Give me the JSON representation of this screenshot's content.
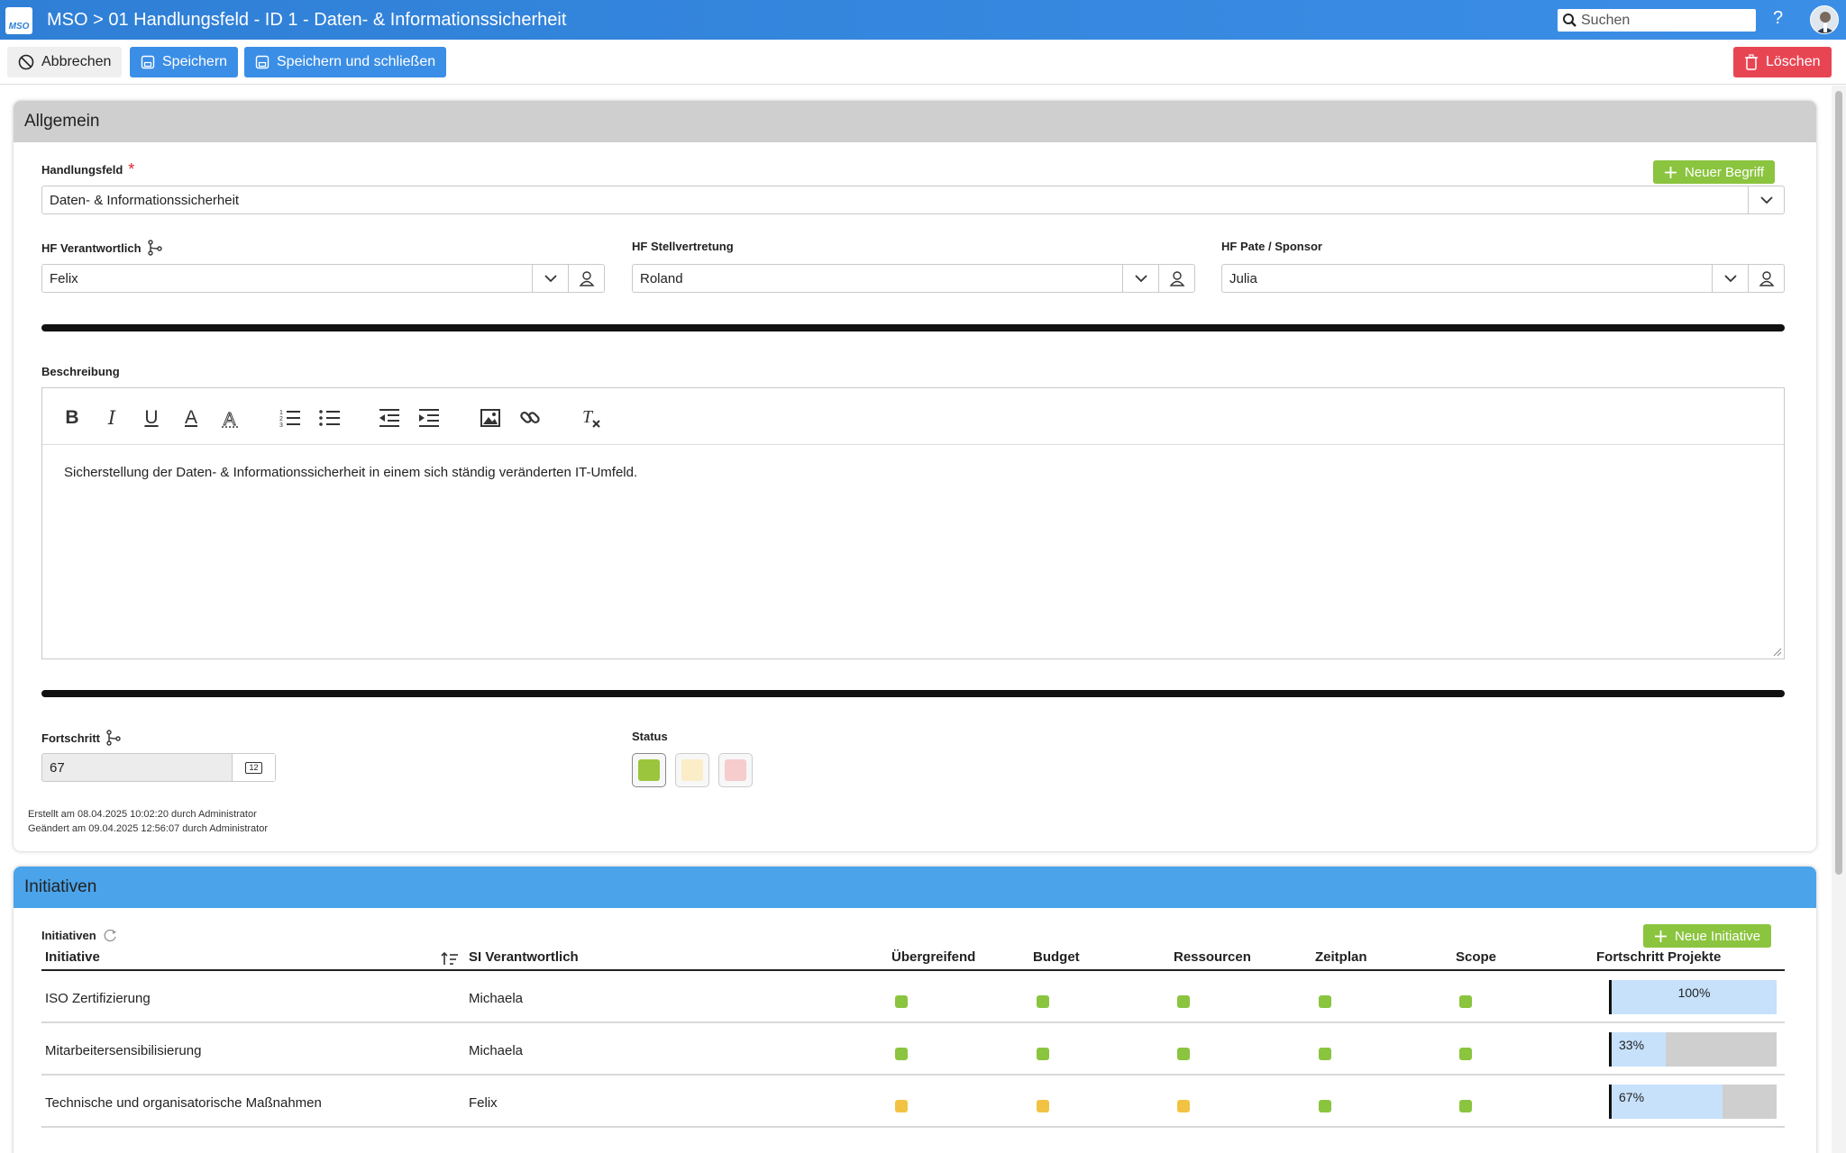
{
  "header": {
    "logo_text": "MSO",
    "title": "MSO > 01 Handlungsfeld - ID 1 - Daten- & Informationssicherheit",
    "search_placeholder": "Suchen",
    "help_label": "?"
  },
  "toolbar": {
    "cancel_label": "Abbrechen",
    "save_label": "Speichern",
    "save_close_label": "Speichern und schließen",
    "delete_label": "Löschen"
  },
  "general": {
    "title": "Allgemein",
    "handlungsfeld_label": "Handlungsfeld",
    "required_mark": "*",
    "new_term_label": "Neuer Begriff",
    "handlungsfeld_value": "Daten- & Informationssicherheit",
    "responsible_label": "HF Verantwortlich",
    "responsible_value": "Felix",
    "deputy_label": "HF Stellvertretung",
    "deputy_value": "Roland",
    "sponsor_label": "HF Pate / Sponsor",
    "sponsor_value": "Julia",
    "description_label": "Beschreibung",
    "description_text": "Sicherstellung der Daten- & Informationssicherheit in einem sich ständig veränderten IT-Umfeld.",
    "progress_label": "Fortschritt",
    "progress_value": "67",
    "progress_unit_icon_text": "12",
    "status_label": "Status",
    "status_options": [
      {
        "name": "green",
        "color": "#9bc53d",
        "selected": true
      },
      {
        "name": "yellow",
        "color": "#faedc8",
        "selected": false
      },
      {
        "name": "red",
        "color": "#f6cccc",
        "selected": false
      }
    ],
    "created": "Erstellt am 08.04.2025 10:02:20 durch Administrator",
    "modified": "Geändert am 09.04.2025 12:56:07 durch Administrator"
  },
  "initiatives": {
    "title": "Initiativen",
    "list_label": "Initiativen",
    "new_label": "Neue Initiative",
    "columns": {
      "initiative": "Initiative",
      "responsible": "SI Verantwortlich",
      "overall": "Übergreifend",
      "budget": "Budget",
      "resources": "Ressourcen",
      "schedule": "Zeitplan",
      "scope": "Scope",
      "progress": "Fortschritt Projekte"
    },
    "rows": [
      {
        "name": "ISO Zertifizierung",
        "responsible": "Michaela",
        "overall": "#8bc43f",
        "budget": "#8bc43f",
        "resources": "#8bc43f",
        "schedule": "#8bc43f",
        "scope": "#8bc43f",
        "progress": 1.0,
        "progress_label": "100%"
      },
      {
        "name": "Mitarbeitersensibilisierung",
        "responsible": "Michaela",
        "overall": "#8bc43f",
        "budget": "#8bc43f",
        "resources": "#8bc43f",
        "schedule": "#8bc43f",
        "scope": "#8bc43f",
        "progress": 0.33,
        "progress_label": "33%"
      },
      {
        "name": "Technische und organisatorische Maßnahmen",
        "responsible": "Felix",
        "overall": "#f2c343",
        "budget": "#f2c343",
        "resources": "#f2c343",
        "schedule": "#8bc43f",
        "scope": "#8bc43f",
        "progress": 0.67,
        "progress_label": "67%"
      }
    ]
  }
}
